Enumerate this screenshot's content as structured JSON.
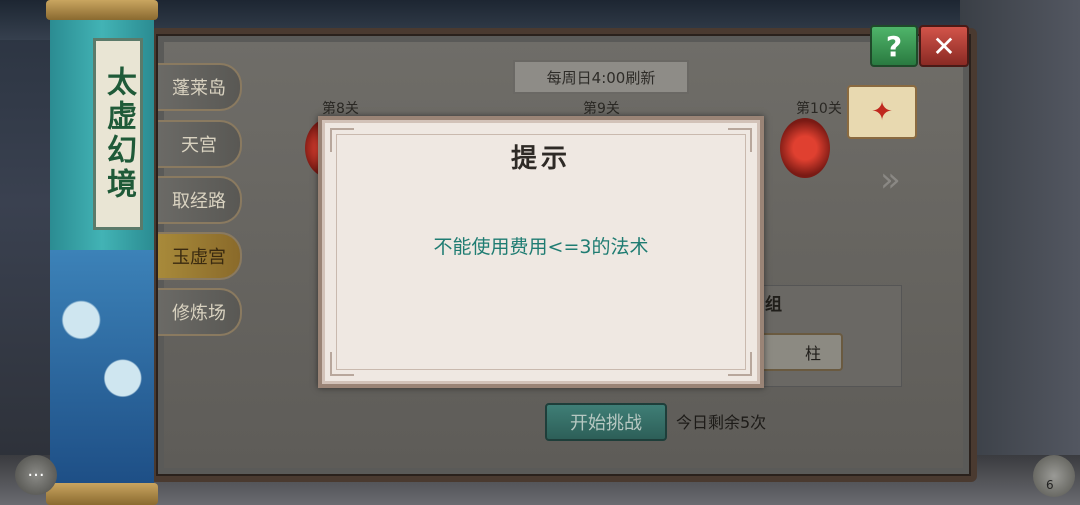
{
  "scroll": {
    "title": "太虚幻境"
  },
  "tabs": [
    {
      "label": "蓬莱岛",
      "active": false
    },
    {
      "label": "天宫",
      "active": false
    },
    {
      "label": "取经路",
      "active": false
    },
    {
      "label": "玉虚宫",
      "active": true
    },
    {
      "label": "修炼场",
      "active": false
    }
  ],
  "header": {
    "refresh_text": "每周日4:00刷新"
  },
  "stages": [
    {
      "label": "第8关"
    },
    {
      "label": "第9关"
    },
    {
      "label": "第10关"
    }
  ],
  "toolbar": {
    "help_label": "?",
    "close_label": "✕"
  },
  "group": {
    "label": "组",
    "pillar_label": "柱"
  },
  "footer": {
    "start_label": "开始挑战",
    "remaining_text": "今日剩余5次"
  },
  "friends": {
    "count": "6"
  },
  "modal": {
    "title": "提示",
    "message": "不能使用费用<=3的法术"
  },
  "icons": {
    "help": "question-icon",
    "close": "close-icon",
    "chat": "chat-icon",
    "friends": "friends-icon",
    "arrow": "chevron-right-icon"
  }
}
